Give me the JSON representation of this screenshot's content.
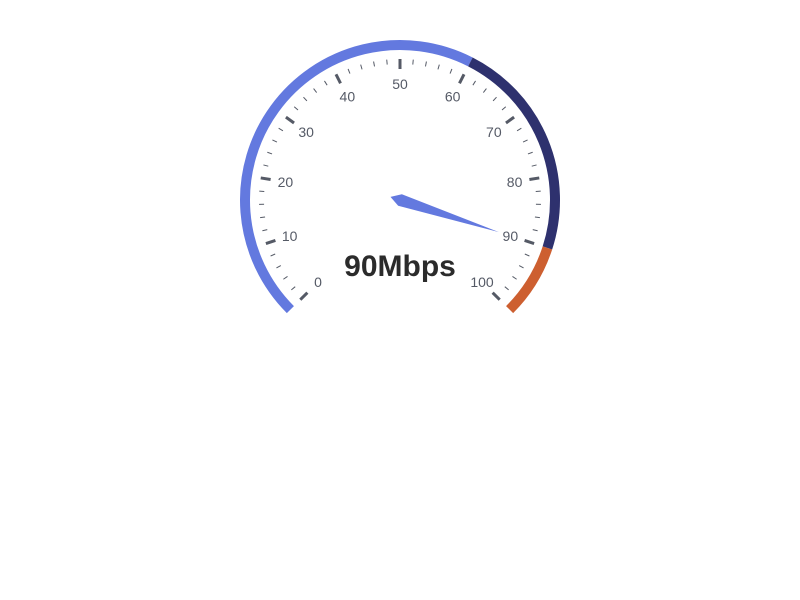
{
  "chart_data": {
    "type": "gauge",
    "title": "",
    "min": 0,
    "max": 100,
    "value": 90,
    "unit": "Mbps",
    "value_label": "90Mbps",
    "major_ticks": [
      0,
      10,
      20,
      30,
      40,
      50,
      60,
      70,
      80,
      90,
      100
    ],
    "tick_labels": [
      "0",
      "10",
      "20",
      "30",
      "40",
      "50",
      "60",
      "70",
      "80",
      "90",
      "100"
    ],
    "minor_ticks_per_interval": 4,
    "bands": [
      {
        "from": 0,
        "to": 60,
        "color": "#6379df"
      },
      {
        "from": 60,
        "to": 90,
        "color": "#2e316e"
      },
      {
        "from": 90,
        "to": 100,
        "color": "#cd5f30"
      }
    ],
    "pointer_color": "#6379df",
    "tick_color": "#555a66"
  }
}
